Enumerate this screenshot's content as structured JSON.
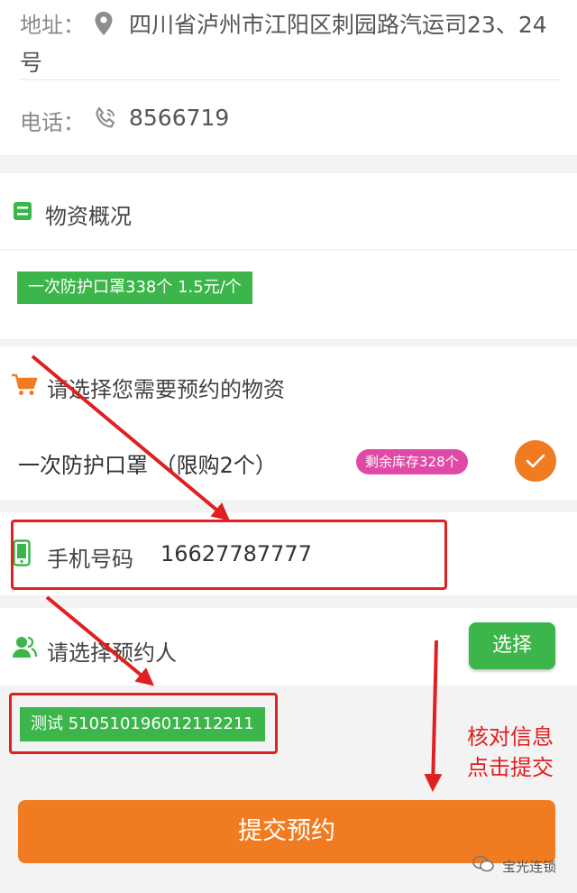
{
  "store": {
    "address_label": "地址：",
    "address_value_line1": "四川省泸州市江阳区刺园路汽运司23、24",
    "address_value_line2": "号",
    "phone_label": "电话：",
    "phone_value": "8566719"
  },
  "supplies_overview": {
    "title": "物资概况",
    "tag": "一次防护口罩338个 1.5元/个"
  },
  "select_supplies": {
    "title": "请选择您需要预约的物资",
    "item_name": "一次防护口罩 （限购2个）",
    "stock_badge": "剩余库存328个"
  },
  "phone_field": {
    "label": "手机号码",
    "value": "16627787777"
  },
  "reserve_person": {
    "title": "请选择预约人",
    "choose_label": "选择",
    "selected_tag": "测试 510510196012112211"
  },
  "annotation": {
    "line1": "核对信息",
    "line2": "点击提交"
  },
  "submit": {
    "label": "提交预约"
  },
  "watermark": {
    "text": "宝光连锁"
  },
  "colors": {
    "accent_green": "#3cb54a",
    "accent_orange": "#f07b21",
    "badge_pink": "#e04aa6",
    "annotation_red": "#e02020"
  }
}
